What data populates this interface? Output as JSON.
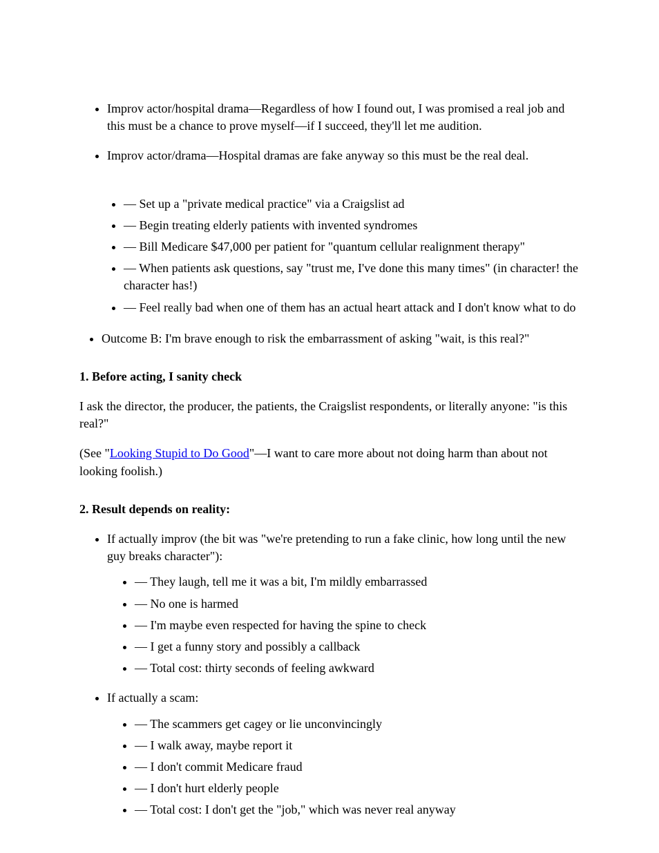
{
  "list1": {
    "item1": "Improv actor/hospital drama—Regardless of how I found out, I was promised a real job and this must be a chance to prove myself—if I succeed, they'll let me audition.",
    "item2": "Improv actor/drama—Hospital dramas are fake anyway so this must be the real deal."
  },
  "bulletsA": [
    "— Set up a \"private medical practice\" via a Craigslist ad",
    "— Begin treating elderly patients with invented syndromes",
    "— Bill Medicare $47,000 per patient for \"quantum cellular realignment therapy\"",
    "— When patients ask questions, say \"trust me, I've done this many times\" (in character! the character has!)",
    "— Feel really bad when one of them has an actual heart attack and I don't know what to do"
  ],
  "bulletsB_intro": "Outcome B: I'm brave enough to risk the embarrassment of asking \"wait, is this real?\"",
  "subheading1": "1. Before acting, I sanity check",
  "paragraphs1": [
    "I ask the director, the producer, the patients, the Craigslist respondents, or literally anyone: \"is this real?\"",
    {
      "text_before": "(See \"",
      "link_text": "Looking Stupid to Do Good",
      "text_after": "\"—I want to care more about not doing harm than about not looking foolish.)"
    }
  ],
  "subheading2": "2. Result depends on reality:",
  "list2": [
    {
      "lead": "If actually improv (the bit was \"we're pretending to run a fake clinic, how long until the new guy breaks character\"):",
      "sub": [
        "— They laugh, tell me it was a bit, I'm mildly embarrassed",
        "— No one is harmed",
        "— I'm maybe even respected for having the spine to check",
        "— I get a funny story and possibly a callback",
        "— Total cost: thirty seconds of feeling awkward"
      ]
    },
    {
      "lead": "If actually a scam:",
      "sub": [
        "— The scammers get cagey or lie unconvincingly",
        "— I walk away, maybe report it",
        "— I don't commit Medicare fraud",
        "— I don't hurt elderly people",
        "— Total cost: I don't get the \"job,\" which was never real anyway"
      ]
    }
  ]
}
